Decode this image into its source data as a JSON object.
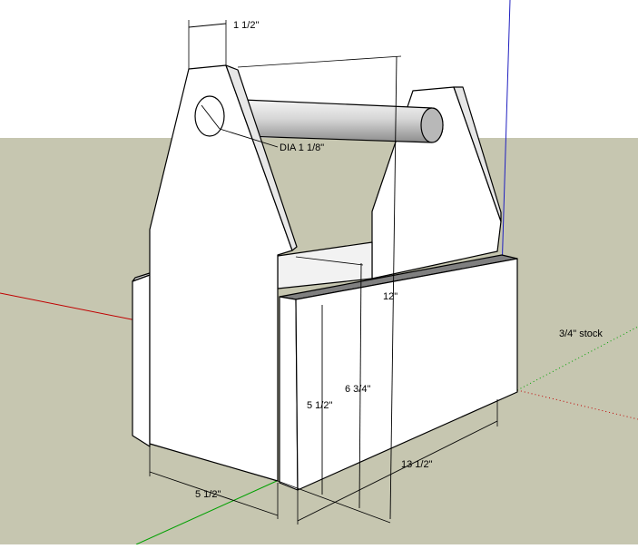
{
  "model": {
    "title": "",
    "material_note": "3/4\" stock"
  },
  "dimensions": {
    "handle_width": "1 1/2\"",
    "hole_diameter": "DIA 1 1/8\"",
    "overall_height": "12\"",
    "side_height": "6 3/4\"",
    "box_height": "5 1/2\"",
    "box_width": "5 1/2\"",
    "box_length": "13 1/2\""
  },
  "colors": {
    "sky": "#ffffff",
    "ground": "#c6c6b0",
    "wood_face": "#ffffff",
    "wood_shade": "#efefef",
    "dowel_light": "#ececec",
    "dowel_dark": "#9a9a9a",
    "edge_dark": "#555555",
    "axis_red": "#c00000",
    "axis_green": "#00a000",
    "axis_blue": "#2020c0"
  }
}
